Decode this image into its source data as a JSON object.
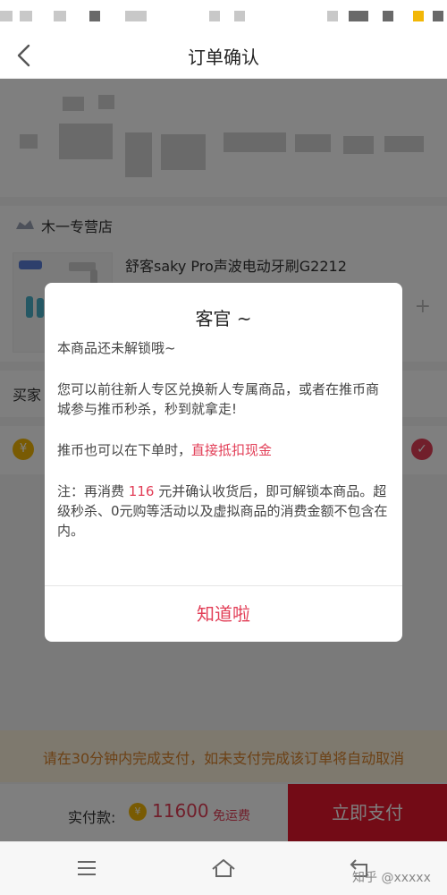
{
  "nav": {
    "title": "订单确认"
  },
  "shop": {
    "name": "木一专营店"
  },
  "product": {
    "name": "舒客saky Pro声波电动牙刷G2212",
    "quantity_add_symbol": "+"
  },
  "buyer": {
    "label": "买家"
  },
  "notice": {
    "text": "请在30分钟内完成支付，如未支付完成该订单将自动取消"
  },
  "payment": {
    "label": "实付款:",
    "amount": "11600",
    "shipping": "免运费",
    "pay_button": "立即支付"
  },
  "dialog": {
    "title": "客官 ~",
    "line1": "本商品还未解锁哦~",
    "line2": "您可以前往新人专区兑换新人专属商品，或者在推币商城参与推币秒杀，秒到就拿走!",
    "line3_prefix": "推币也可以在下单时，",
    "line3_highlight": "直接抵扣现金",
    "line4_prefix": "注：再消费 ",
    "line4_amount": "116",
    "line4_suffix": " 元并确认收货后，即可解锁本商品。超级秒杀、0元购等活动以及虚拟商品的消费金额不包含在内。",
    "confirm_button": "知道啦"
  },
  "watermark": {
    "text": "知乎 @xxxxx"
  },
  "icons": {
    "back": "chevron-left-icon",
    "menu": "menu-icon",
    "home": "home-icon",
    "return": "return-icon"
  },
  "colors": {
    "accent": "#e23e57",
    "pay_button": "#e6172d",
    "coin": "#f2b707",
    "notice_bg": "#fdf2dc",
    "notice_text": "#d9822b"
  }
}
